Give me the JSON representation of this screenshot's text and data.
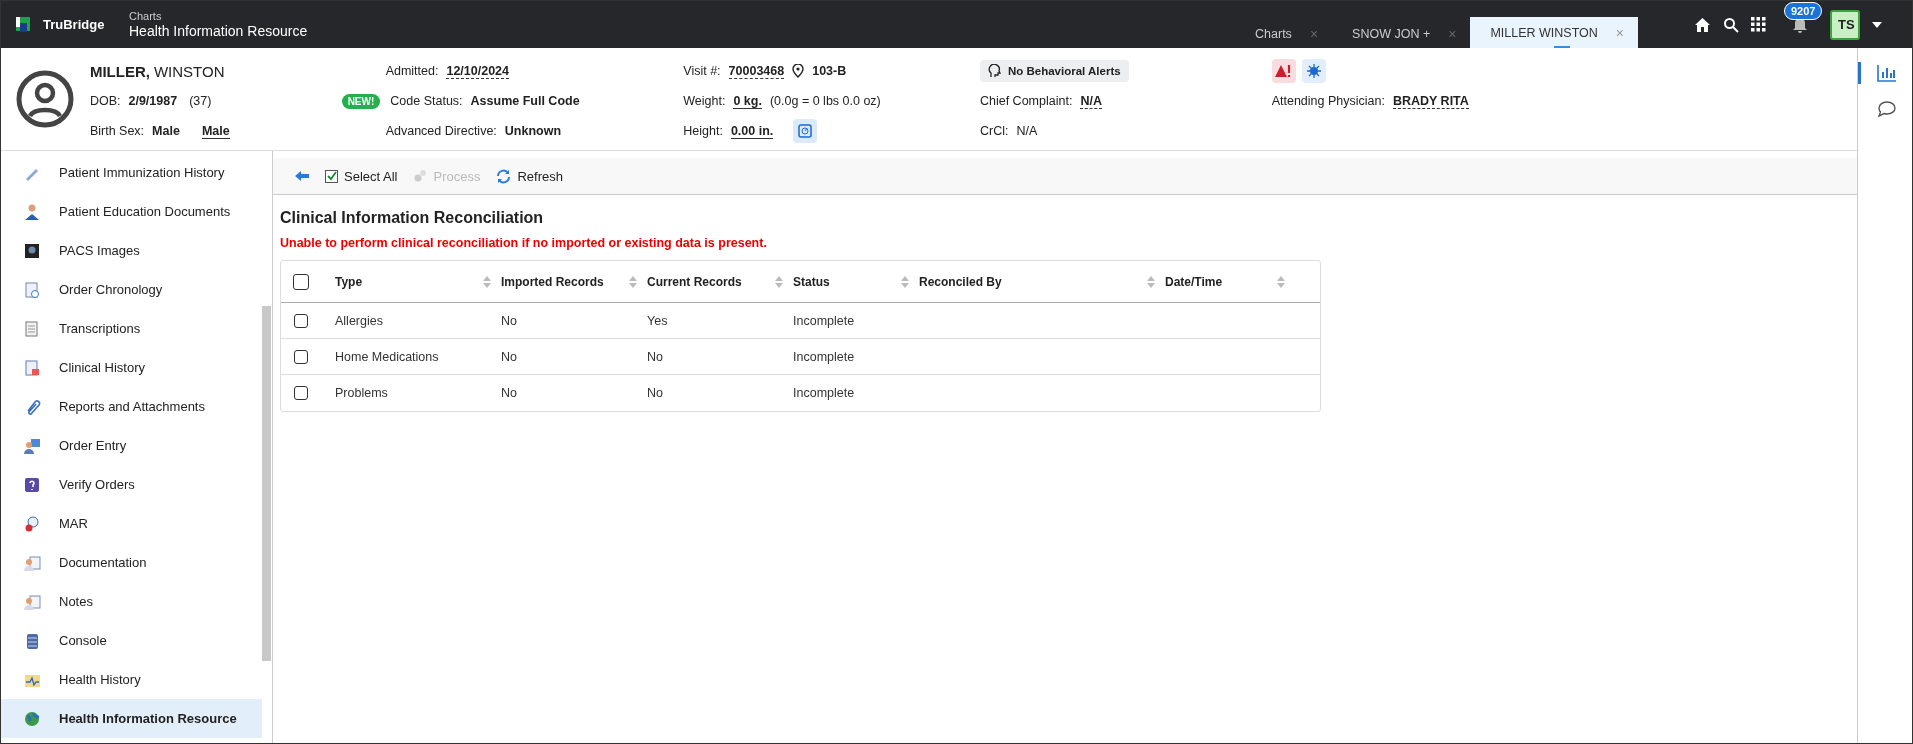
{
  "app": {
    "brand": "TruBridge",
    "breadcrumb": "Charts",
    "title": "Health Information Resource"
  },
  "tabs": [
    {
      "label": "Charts",
      "close": "×",
      "selected": false
    },
    {
      "label": "SNOW JON +",
      "close": "×",
      "selected": false
    },
    {
      "label": "MILLER WINSTON",
      "close": "×",
      "selected": true
    }
  ],
  "notifications": {
    "count": "9207"
  },
  "user": {
    "initials": "TS"
  },
  "patient": {
    "last_name": "MILLER,",
    "first_name": "WINSTON",
    "dob_label": "DOB:",
    "dob": "2/9/1987",
    "age": "(37)",
    "sex_label": "Birth Sex:",
    "birth_sex": "Male",
    "sex": "Male"
  },
  "header_columns": [
    {
      "rows": [
        {
          "kind": "field",
          "label": "Admitted:",
          "value": "12/10/2024",
          "link": true,
          "bold": true
        },
        {
          "kind": "field",
          "label": "Code Status:",
          "value": "Assume Full Code",
          "link": false,
          "underlined": false,
          "bold": true,
          "badge": "NEW!"
        },
        {
          "kind": "field",
          "label": "Advanced Directive:",
          "value": "Unknown",
          "link": false,
          "underlined": false,
          "bold": true
        }
      ]
    },
    {
      "rows": [
        {
          "kind": "field",
          "label": "Visit #:",
          "value": "70003468",
          "link": true,
          "bold": true,
          "room": "103-B"
        },
        {
          "kind": "field",
          "label": "Weight:",
          "value": "0 kg.",
          "link": false,
          "underlined": true,
          "bold": true,
          "note": "(0.0g = 0 lbs 0.0 oz)"
        },
        {
          "kind": "field",
          "label": "Height:",
          "value": "0.00 in.",
          "link": false,
          "underlined": true,
          "bold": true,
          "scale_button": true
        }
      ]
    },
    {
      "rows": [
        {
          "kind": "alert",
          "label": "No Behavioral Alerts"
        },
        {
          "kind": "field",
          "label": "Chief Complaint:",
          "value": "N/A",
          "link": true,
          "bold": true
        },
        {
          "kind": "field",
          "label": "CrCl:",
          "value": "N/A",
          "link": false,
          "underlined": false,
          "bold": false
        }
      ]
    },
    {
      "rows": [
        {
          "kind": "icons"
        },
        {
          "kind": "field",
          "label": "Attending Physician:",
          "value": "BRADY RITA",
          "link": true,
          "bold": true
        }
      ]
    }
  ],
  "sidebar": {
    "items": [
      {
        "label": "Patient Immunization History",
        "selected": false
      },
      {
        "label": "Patient Education Documents",
        "selected": false
      },
      {
        "label": "PACS Images",
        "selected": false
      },
      {
        "label": "Order Chronology",
        "selected": false
      },
      {
        "label": "Transcriptions",
        "selected": false
      },
      {
        "label": "Clinical History",
        "selected": false
      },
      {
        "label": "Reports and Attachments",
        "selected": false
      },
      {
        "label": "Order Entry",
        "selected": false
      },
      {
        "label": "Verify Orders",
        "selected": false
      },
      {
        "label": "MAR",
        "selected": false
      },
      {
        "label": "Documentation",
        "selected": false
      },
      {
        "label": "Notes",
        "selected": false
      },
      {
        "label": "Console",
        "selected": false
      },
      {
        "label": "Health History",
        "selected": false
      },
      {
        "label": "Health Information Resource",
        "selected": true
      }
    ]
  },
  "toolbar": {
    "select_all": {
      "label": "Select All",
      "checked": true
    },
    "process": {
      "label": "Process",
      "disabled": true
    },
    "refresh": {
      "label": "Refresh",
      "disabled": false
    }
  },
  "section_title": "Clinical Information Reconciliation",
  "error_message": "Unable to perform clinical reconciliation if no imported or existing data is present.",
  "table": {
    "header_checked": false,
    "columns": [
      {
        "label": "Type",
        "sortable": true
      },
      {
        "label": "Imported Records",
        "sortable": true
      },
      {
        "label": "Current Records",
        "sortable": true
      },
      {
        "label": "Status",
        "sortable": true
      },
      {
        "label": "Reconciled By",
        "sortable": true
      },
      {
        "label": "Date/Time",
        "sortable": true
      }
    ],
    "rows": [
      {
        "checked": false,
        "cells": [
          "Allergies",
          "No",
          "Yes",
          "Incomplete"
        ]
      },
      {
        "checked": false,
        "cells": [
          "Home Medications",
          "No",
          "No",
          "Incomplete"
        ]
      },
      {
        "checked": false,
        "cells": [
          "Problems",
          "No",
          "No",
          "Incomplete"
        ]
      }
    ]
  }
}
